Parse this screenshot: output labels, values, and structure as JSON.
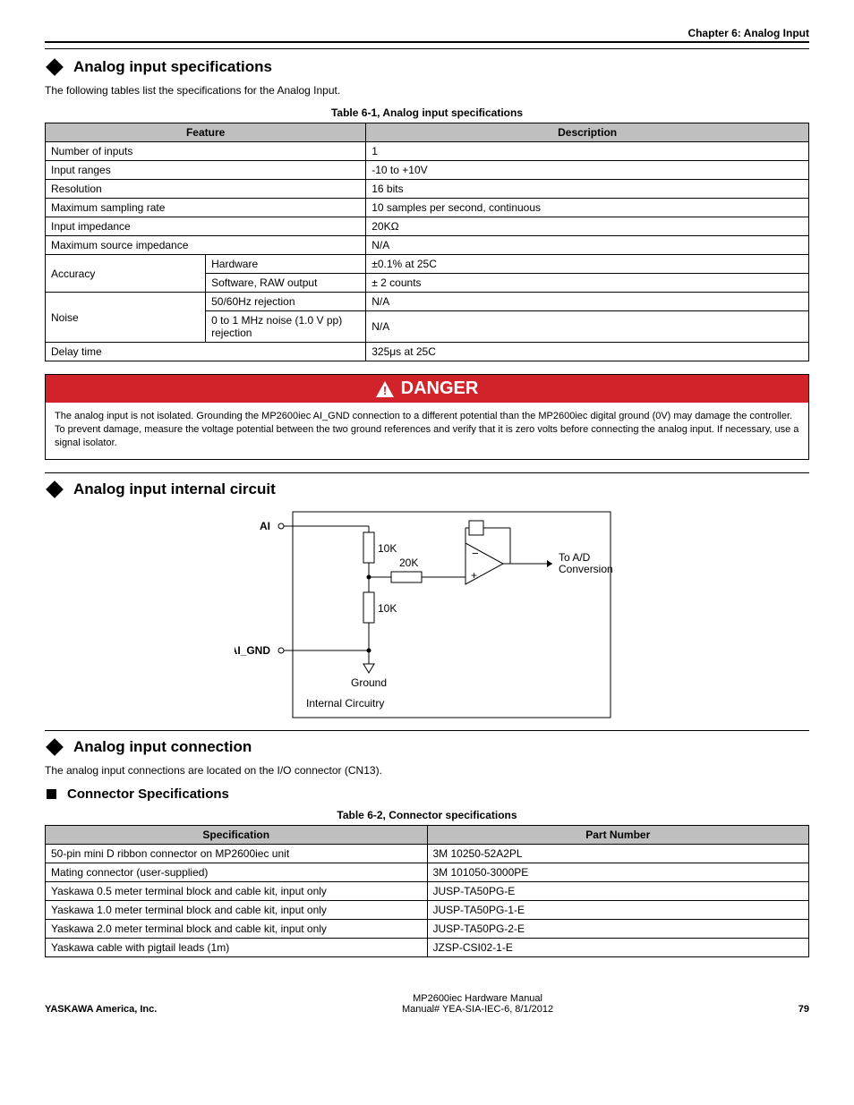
{
  "chapter": "Chapter 6: Analog Input",
  "sections": {
    "spec": {
      "title": "Analog input specifications",
      "intro": "The following tables list the specifications for the Analog Input.",
      "table_title": "Table 6-1, Analog input specifications",
      "headers": [
        "Feature",
        "Description"
      ],
      "rows": [
        [
          "Number of inputs",
          "1"
        ],
        [
          "Input ranges",
          "-10 to +10V"
        ],
        [
          "Resolution",
          "16 bits"
        ],
        [
          "Maximum sampling rate",
          "10 samples per second, continuous"
        ],
        [
          "Input impedance",
          "20KΩ"
        ],
        [
          "Maximum source impedance",
          "N/A"
        ],
        [
          "Accuracy|Hardware",
          "±0.1% at 25C"
        ],
        [
          "Accuracy|Software, RAW output",
          "± 2 counts"
        ],
        [
          "Noise|50/60Hz rejection",
          "N/A"
        ],
        [
          "Noise|0 to 1 MHz noise (1.0 V pp) rejection",
          "N/A"
        ],
        [
          "Delay time",
          "325μs at 25C"
        ]
      ],
      "danger": {
        "label": "DANGER",
        "body": "The analog input is not isolated. Grounding the MP2600iec AI_GND connection to a different potential than the MP2600iec digital ground (0V) may damage the controller. To prevent damage, measure the voltage potential between the two ground references and verify that it is zero volts before connecting the analog input. If necessary, use a signal isolator."
      }
    },
    "circuit": {
      "title": "Analog input internal circuit",
      "labels": {
        "ai": "AI",
        "ai_gnd": "AI_GND",
        "r10k_top": "10K",
        "r10k_bot": "10K",
        "r20k": "20K",
        "ground": "Ground",
        "to_ad": "To A/D",
        "conversion": "Conversion",
        "internal": "Internal Circuitry"
      }
    },
    "conn": {
      "title": "Analog input connection",
      "intro": "The analog input connections are located on the I/O connector (CN13).",
      "sub_title": "Connector Specifications",
      "table_title": "Table 6-2, Connector specifications",
      "headers": [
        "Specification",
        "Part Number"
      ],
      "rows": [
        [
          "50-pin mini D ribbon connector on MP2600iec unit",
          "3M 10250-52A2PL"
        ],
        [
          "Mating connector (user-supplied)",
          "3M 101050-3000PE"
        ],
        [
          "Yaskawa 0.5 meter terminal block and cable kit, input only",
          "JUSP-TA50PG-E"
        ],
        [
          "Yaskawa 1.0 meter terminal block and cable kit, input only",
          "JUSP-TA50PG-1-E"
        ],
        [
          "Yaskawa 2.0 meter terminal block and cable kit, input only",
          "JUSP-TA50PG-2-E"
        ],
        [
          "Yaskawa cable with pigtail leads (1m)",
          "JZSP-CSI02-1-E"
        ]
      ]
    }
  },
  "footer": {
    "company": "YASKAWA America, Inc.",
    "doc_title": "MP2600iec Hardware Manual",
    "doc_no": "Manual# YEA-SIA-IEC-6, 8/1/2012",
    "page": "79"
  }
}
